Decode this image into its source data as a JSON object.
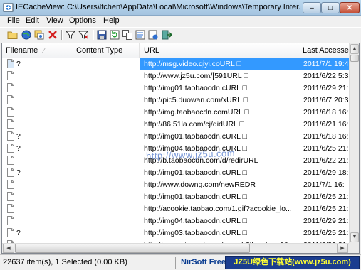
{
  "window": {
    "title": "IECacheView:  C:\\Users\\lfchen\\AppData\\Local\\Microsoft\\Windows\\Temporary Inter...",
    "icon": "iecacheview-app-icon",
    "controls": {
      "minimize": "–",
      "maximize": "□",
      "close": "✕"
    }
  },
  "menu": {
    "file": "File",
    "edit": "Edit",
    "view": "View",
    "options": "Options",
    "help": "Help"
  },
  "toolbar": {
    "icons": [
      "open-folder-icon",
      "globe-icon",
      "copy-cache-icon",
      "delete-icon",
      "filter-icon",
      "filter-clear-icon",
      "save-icon",
      "refresh-icon",
      "copy-icon",
      "properties-icon",
      "exit-icon"
    ]
  },
  "columns": {
    "filename": "Filename",
    "content_type": "Content Type",
    "url": "URL",
    "last_accessed": "Last Accessed"
  },
  "rows": [
    {
      "filename": "?",
      "content_type": "",
      "url": "http://msg.video.qiyi.coURL □",
      "last_accessed": "2011/7/1 19:4",
      "selected": true
    },
    {
      "filename": "",
      "content_type": "",
      "url": "http://www.jz5u.com/[591URL □",
      "last_accessed": "2011/6/22 5:3"
    },
    {
      "filename": "",
      "content_type": "",
      "url": "http://img01.taobaocdn.cURL □",
      "last_accessed": "2011/6/29 21:"
    },
    {
      "filename": "",
      "content_type": "",
      "url": "http://pic5.duowan.com/xURL □",
      "last_accessed": "2011/6/7 20:3"
    },
    {
      "filename": "",
      "content_type": "",
      "url": "http://img.taobaocdn.comURL □",
      "last_accessed": "2011/6/18 16:"
    },
    {
      "filename": "",
      "content_type": "",
      "url": "http://86.51la.com/cj/didURL □",
      "last_accessed": "2011/6/21 16:"
    },
    {
      "filename": "?",
      "content_type": "",
      "url": "http://img01.taobaocdn.cURL □",
      "last_accessed": "2011/6/18 16:"
    },
    {
      "filename": "?",
      "content_type": "",
      "url": "http://img04.taobaocdn.cURL □",
      "last_accessed": "2011/6/25 21:"
    },
    {
      "filename": "",
      "content_type": "",
      "url": "http://b.taobaocdn.com/d/redirURL",
      "last_accessed": "2011/6/22 21:"
    },
    {
      "filename": "?",
      "content_type": "",
      "url": "http://img01.taobaocdn.cURL □",
      "last_accessed": "2011/6/29 18:"
    },
    {
      "filename": "",
      "content_type": "",
      "url": "http://www.downg.com/newREDR",
      "last_accessed": "2011/7/1 16:"
    },
    {
      "filename": "",
      "content_type": "",
      "url": "http://img01.taobaocdn.cURL □",
      "last_accessed": "2011/6/25 21:"
    },
    {
      "filename": "",
      "content_type": "",
      "url": "http://acookie.taobao.com/1.gif?acookie_lo...",
      "last_accessed": "2011/6/25 21:"
    },
    {
      "filename": "",
      "content_type": "",
      "url": "http://img04.taobaocdn.cURL □",
      "last_accessed": "2011/6/29 21:"
    },
    {
      "filename": "?",
      "content_type": "",
      "url": "http://img03.taobaocdn.cURL □",
      "last_accessed": "2011/6/25 21:"
    },
    {
      "filename": "",
      "content_type": "",
      "url": "http://www.atpanel.com/search?lf_aclog=10-...",
      "last_accessed": "2011/6/22 21:"
    }
  ],
  "watermark": "http://www.jz5u.com",
  "status": {
    "count": "22637 item(s), 1 Selected  (0.00 KB)",
    "link": "NirSoft Freeware",
    "badge": "JZ5U绿色下载站(www.jz5u.com)"
  },
  "colors": {
    "selection": "#3399ff",
    "badge_bg": "#1b3d8f",
    "badge_text": "#ffff33"
  }
}
